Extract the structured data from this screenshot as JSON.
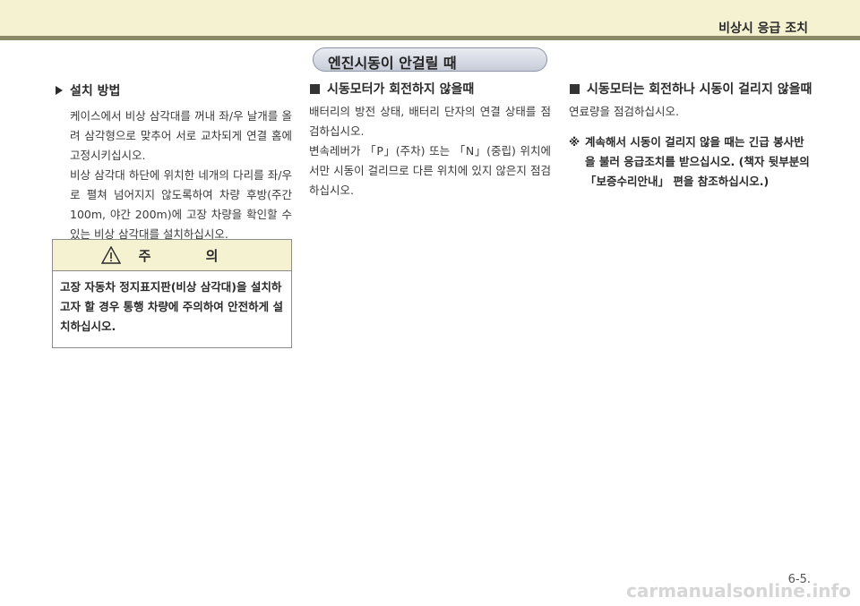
{
  "header": {
    "title": "비상시 응급 조치"
  },
  "section": {
    "title": "엔진시동이 안걸릴 때"
  },
  "left": {
    "heading": "설치 방법",
    "paragraph1": "케이스에서 비상 삼각대를 꺼내 좌/우 날개를 올려 삼각형으로 맞추어 서로 교차되게 연결 홈에 고정시키십시오.",
    "paragraph2": "비상 삼각대 하단에 위치한 네개의 다리를 좌/우로 펼쳐 넘어지지 않도록하여 차량 후방(주간 100m, 야간 200m)에 고장 차량을 확인할 수 있는 비상 삼각대를 설치하십시오."
  },
  "caution": {
    "title": "주 의",
    "body": "고장 자동차 정지표지판(비상 삼각대)을 설치하고자 할 경우 통행 차량에 주의하여 안전하게 설치하십시오."
  },
  "middle": {
    "heading": "시동모터가 회전하지 않을때",
    "paragraph1": "배터리의 방전 상태, 배터리 단자의 연결 상태를 점검하십시오.",
    "paragraph2": "변속레버가 「P」(주차) 또는 「N」(중립) 위치에서만 시동이 걸리므로 다른 위치에 있지 않은지 점검하십시오."
  },
  "right": {
    "heading": "시동모터는 회전하나 시동이 걸리지 않을때",
    "paragraph": "연료량을 점검하십시오.",
    "note_mark": "※",
    "note": "계속해서 시동이 걸리지 않을 때는 긴급 봉사반을 불러 응급조치를 받으십시오. (책자 뒷부분의 「보증수리안내」 편을 참조하십시오.)"
  },
  "footer": {
    "page_number": "6-5.",
    "watermark": "carmanualsonline.info"
  }
}
